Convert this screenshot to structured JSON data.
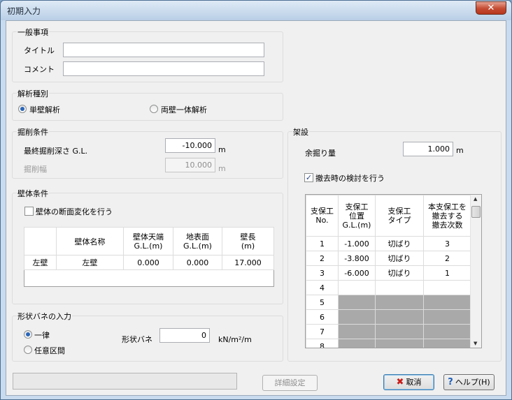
{
  "window": {
    "title": "初期入力",
    "close_glyph": "✕"
  },
  "general": {
    "legend": "一般事項",
    "title_label": "タイトル",
    "title_value": "",
    "comment_label": "コメント",
    "comment_value": ""
  },
  "analysis": {
    "legend": "解析種別",
    "option1": "単壁解析",
    "option1_checked": true,
    "option2": "両壁一体解析",
    "option2_checked": false
  },
  "excavation": {
    "legend": "掘削条件",
    "depth_label": "最終掘削深さ G.L.",
    "depth_value": "-10.000",
    "depth_unit": "m",
    "width_label": "掘削幅",
    "width_value": "10.000",
    "width_unit": "m",
    "width_disabled": true
  },
  "wall": {
    "legend": "壁体条件",
    "section_change_label": "壁体の断面変化を行う",
    "section_change_checked": false,
    "headers": [
      "",
      "壁体名称",
      "壁体天端\nG.L.(m)",
      "地表面\nG.L.(m)",
      "壁長\n(m)"
    ],
    "rows": [
      [
        "左壁",
        "左壁",
        "0.000",
        "0.000",
        "17.000"
      ]
    ]
  },
  "spring": {
    "legend": "形状バネの入力",
    "option1": "一律",
    "option1_checked": true,
    "option2": "任意区間",
    "option2_checked": false,
    "spring_label": "形状バネ",
    "spring_value": "0",
    "spring_unit": "kN/m²/m"
  },
  "erection": {
    "legend": "架設",
    "extra_label": "余掘り量",
    "extra_value": "1.000",
    "extra_unit": "m",
    "removal_check_label": "撤去時の検討を行う",
    "removal_check_checked": true,
    "headers": [
      "支保工\nNo.",
      "支保工\n位置\nG.L.(m)",
      "支保工\nタイプ",
      "本支保工を\n撤去する\n撤去次数"
    ],
    "rows": [
      [
        "1",
        "-1.000",
        "切ばり",
        "3"
      ],
      [
        "2",
        "-3.800",
        "切ばり",
        "2"
      ],
      [
        "3",
        "-6.000",
        "切ばり",
        "1"
      ],
      [
        "4",
        "",
        "",
        ""
      ],
      [
        "5",
        "",
        "",
        ""
      ],
      [
        "6",
        "",
        "",
        ""
      ],
      [
        "7",
        "",
        "",
        ""
      ],
      [
        "8",
        "",
        "",
        ""
      ]
    ]
  },
  "buttons": {
    "details": "詳細設定",
    "cancel": "取消",
    "help": "ヘルプ(H)",
    "cancel_icon": "✖",
    "help_icon": "?"
  },
  "status": {
    "text": ""
  }
}
